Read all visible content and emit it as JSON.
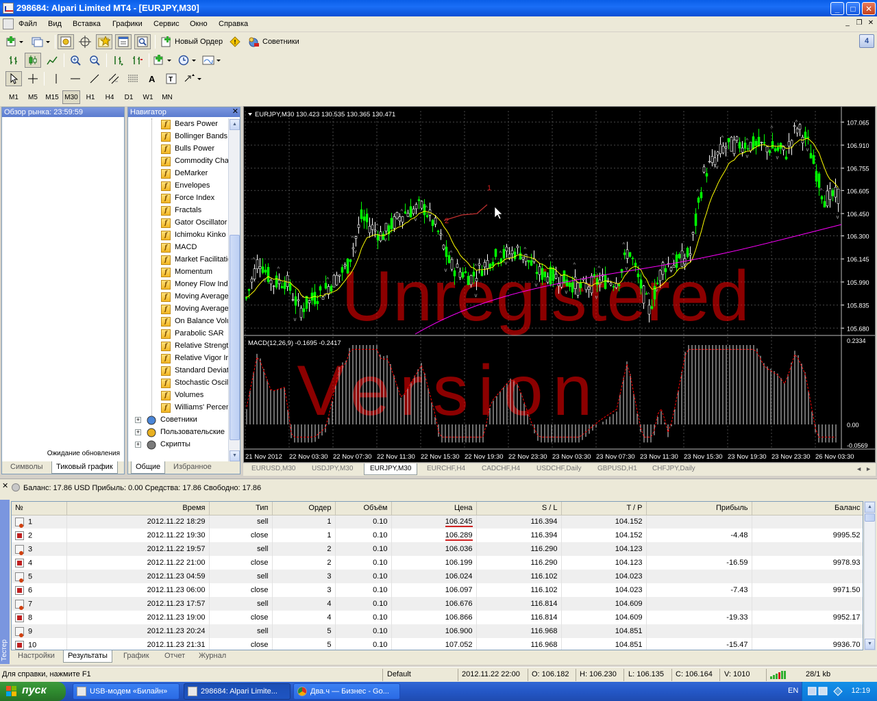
{
  "window": {
    "title": "298684: Alpari Limited MT4 - [EURJPY,M30]"
  },
  "menu": [
    "Файл",
    "Вид",
    "Вставка",
    "Графики",
    "Сервис",
    "Окно",
    "Справка"
  ],
  "toolbar": {
    "new_order_label": "Новый Ордер",
    "advisors_label": "Советники",
    "notify_badge": "4"
  },
  "timeframes": [
    "M1",
    "M5",
    "M15",
    "M30",
    "H1",
    "H4",
    "D1",
    "W1",
    "MN"
  ],
  "active_timeframe": "M30",
  "market_watch": {
    "title": "Обзор рынка: 23:59:59",
    "status": "Ожидание обновления",
    "tabs": [
      "Символы",
      "Тиковый график"
    ],
    "active_tab": "Тиковый график"
  },
  "navigator": {
    "title": "Навигатор",
    "indicators": [
      "Bears Power",
      "Bollinger Bands",
      "Bulls Power",
      "Commodity Chan",
      "DeMarker",
      "Envelopes",
      "Force Index",
      "Fractals",
      "Gator Oscillator",
      "Ichimoku Kinko H",
      "MACD",
      "Market Facilitatio",
      "Momentum",
      "Money Flow Ind",
      "Moving Average",
      "Moving Average",
      "On Balance Volu",
      "Parabolic SAR",
      "Relative Strengt",
      "Relative Vigor Ir",
      "Standard Deviat",
      "Stochastic Oscil",
      "Volumes",
      "Williams' Percent"
    ],
    "groups": [
      "Советники",
      "Пользовательские",
      "Скрипты"
    ],
    "tabs": [
      "Общие",
      "Избранное"
    ],
    "active_tab": "Общие"
  },
  "chart": {
    "header": "EURJPY,M30  130.423 130.535 130.365 130.471",
    "macd_header": "MACD(12,26,9) -0.1695 -0.2417",
    "watermark_line1": "Unregistered",
    "watermark_line2": "Version",
    "price_ticks": [
      "107.065",
      "106.910",
      "106.755",
      "106.605",
      "106.450",
      "106.300",
      "106.145",
      "105.990",
      "105.835",
      "105.680"
    ],
    "macd_ticks": [
      "0.2334",
      "0.00",
      "-0.0569"
    ],
    "time_ticks": [
      "21 Nov 2012",
      "22 Nov 03:30",
      "22 Nov 07:30",
      "22 Nov 11:30",
      "22 Nov 15:30",
      "22 Nov 19:30",
      "22 Nov 23:30",
      "23 Nov 03:30",
      "23 Nov 07:30",
      "23 Nov 11:30",
      "23 Nov 15:30",
      "23 Nov 19:30",
      "23 Nov 23:30",
      "26 Nov 03:30"
    ],
    "trade_marks": [
      "1",
      "2"
    ]
  },
  "chart_tabs": [
    "EURUSD,M30",
    "USDJPY,M30",
    "EURJPY,M30",
    "EURCHF,H4",
    "CADCHF,H4",
    "USDCHF,Daily",
    "GBPUSD,H1",
    "CHFJPY,Daily"
  ],
  "active_chart_tab": "EURJPY,M30",
  "terminal": {
    "side_label": "Тестер",
    "balance_line": "Баланс: 17.86 USD  Прибыль: 0.00  Средства: 17.86  Свободно: 17.86",
    "columns": [
      "№",
      "Время",
      "Тип",
      "Ордер",
      "Объём",
      "Цена",
      "S / L",
      "T / P",
      "Прибыль",
      "Баланс"
    ],
    "rows": [
      [
        "1",
        "2012.11.22 18:29",
        "sell",
        "1",
        "0.10",
        "106.245",
        "116.394",
        "104.152",
        "",
        ""
      ],
      [
        "2",
        "2012.11.22 19:30",
        "close",
        "1",
        "0.10",
        "106.289",
        "116.394",
        "104.152",
        "-4.48",
        "9995.52"
      ],
      [
        "3",
        "2012.11.22 19:57",
        "sell",
        "2",
        "0.10",
        "106.036",
        "116.290",
        "104.123",
        "",
        ""
      ],
      [
        "4",
        "2012.11.22 21:00",
        "close",
        "2",
        "0.10",
        "106.199",
        "116.290",
        "104.123",
        "-16.59",
        "9978.93"
      ],
      [
        "5",
        "2012.11.23 04:59",
        "sell",
        "3",
        "0.10",
        "106.024",
        "116.102",
        "104.023",
        "",
        ""
      ],
      [
        "6",
        "2012.11.23 06:00",
        "close",
        "3",
        "0.10",
        "106.097",
        "116.102",
        "104.023",
        "-7.43",
        "9971.50"
      ],
      [
        "7",
        "2012.11.23 17:57",
        "sell",
        "4",
        "0.10",
        "106.676",
        "116.814",
        "104.609",
        "",
        ""
      ],
      [
        "8",
        "2012.11.23 19:00",
        "close",
        "4",
        "0.10",
        "106.866",
        "116.814",
        "104.609",
        "-19.33",
        "9952.17"
      ],
      [
        "9",
        "2012.11.23 20:24",
        "sell",
        "5",
        "0.10",
        "106.900",
        "116.968",
        "104.851",
        "",
        ""
      ],
      [
        "10",
        "2012.11.23 21:31",
        "close",
        "5",
        "0.10",
        "107.052",
        "116.968",
        "104.851",
        "-15.47",
        "9936.70"
      ]
    ],
    "tabs": [
      "Настройки",
      "Результаты",
      "График",
      "Отчет",
      "Журнал"
    ],
    "active_tab": "Результаты"
  },
  "statusbar": {
    "help": "Для справки, нажмите F1",
    "profile": "Default",
    "datetime": "2012.11.22 22:00",
    "open": "O: 106.182",
    "high": "H: 106.230",
    "low": "L: 106.135",
    "close": "C: 106.164",
    "volume": "V: 1010",
    "traffic": "28/1 kb"
  },
  "taskbar": {
    "start": "пуск",
    "tasks": [
      "USB-модем «Билайн»",
      "298684: Alpari Limite...",
      "Два.ч — Бизнес - Go..."
    ],
    "lang": "EN",
    "clock": "12:19"
  },
  "colors": {
    "bull_candle": "#00ff00",
    "bear_candle": "#ffffff",
    "ma_fast": "#ffff00",
    "ma_slow": "#ff00ff",
    "macd_signal": "#ff0000",
    "watermark": "#ff0000"
  }
}
